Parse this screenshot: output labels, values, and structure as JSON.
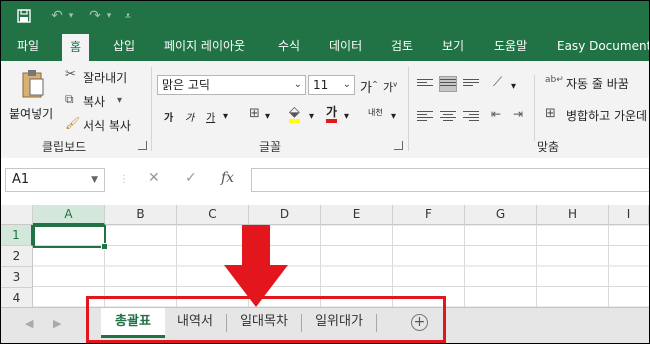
{
  "window": {
    "qat_icons": [
      "save-icon",
      "undo-icon",
      "redo-icon",
      "customize-qat-icon"
    ]
  },
  "tabs": [
    "파일",
    "홈",
    "삽입",
    "페이지 레이아웃",
    "수식",
    "데이터",
    "검토",
    "보기",
    "도움말",
    "Easy Document C"
  ],
  "active_tab": "홈",
  "ribbon": {
    "clipboard": {
      "paste": "붙여넣기",
      "cut": "잘라내기",
      "copy": "복사",
      "format_painter": "서식 복사",
      "group": "클립보드"
    },
    "font": {
      "name": "맑은 고딕",
      "size": "11",
      "bold": "가",
      "italic": "가",
      "underline": "가",
      "font_color": "가",
      "phonetic": "내천",
      "group": "글꼴"
    },
    "alignment": {
      "wrap_text": "자동 줄 바꿈",
      "merge": "병합하고 가운데",
      "group": "맞춤"
    }
  },
  "formula_bar": {
    "name_box": "A1",
    "cancel": "✕",
    "enter": "✓",
    "fx": "fx",
    "value": ""
  },
  "grid": {
    "columns": [
      "A",
      "B",
      "C",
      "D",
      "E",
      "F",
      "G",
      "H",
      "I"
    ],
    "rows": [
      "1",
      "2",
      "3",
      "4"
    ],
    "active_cell": "A1"
  },
  "sheets": {
    "tabs": [
      "총괄표",
      "내역서",
      "일대목차",
      "일위대가"
    ],
    "active": "총괄표",
    "add_label": "+"
  },
  "annotation": {
    "color": "#e3161e"
  },
  "colors": {
    "accent": "#217346"
  }
}
